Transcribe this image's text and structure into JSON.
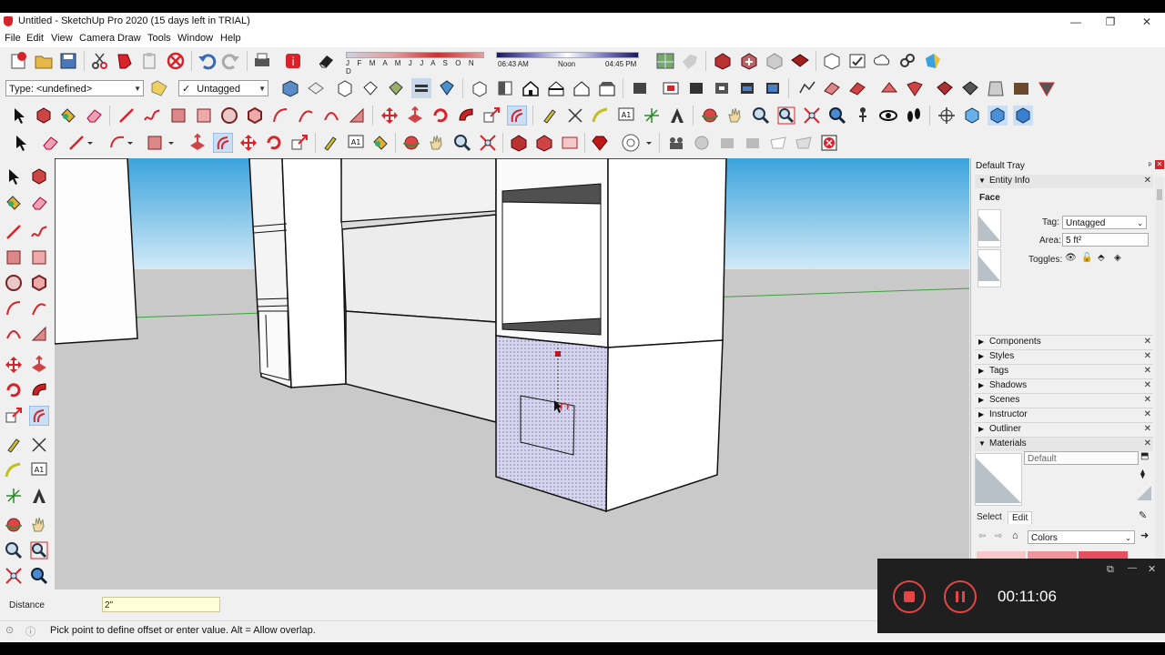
{
  "window": {
    "title": "Untitled - SketchUp Pro 2020 (15 days left in TRIAL)",
    "minimize_glyph": "—",
    "restore_glyph": "❐",
    "close_glyph": "✕"
  },
  "menu": [
    "File",
    "Edit",
    "View",
    "Camera",
    "Draw",
    "Tools",
    "Window",
    "Help"
  ],
  "shadow_settings": {
    "months": "J F M A M J J A S O N D",
    "time_start": "06:43 AM",
    "time_mid": "Noon",
    "time_end": "04:45 PM"
  },
  "toolbar2": {
    "type_combo": "Type: <undefined>",
    "tag_combo_check": "✓",
    "tag_combo": "Untagged"
  },
  "default_tray": {
    "title": "Default Tray",
    "pin_glyph": "ᵖ",
    "close_glyph": "✕",
    "entity_info": {
      "title": "Entity Info",
      "entity_type": "Face",
      "tag_label": "Tag:",
      "tag_value": "Untagged",
      "area_label": "Area:",
      "area_value": "5 ft²",
      "toggles_label": "Toggles:"
    },
    "panels": [
      "Components",
      "Styles",
      "Tags",
      "Shadows",
      "Scenes",
      "Instructor",
      "Outliner"
    ],
    "materials": {
      "title": "Materials",
      "material_name": "Default",
      "tab_select": "Select",
      "tab_edit": "Edit",
      "library_combo": "Colors",
      "swatch_colors": [
        "#f8c8c8",
        "#f1949b",
        "#e9505f"
      ]
    }
  },
  "vcb": {
    "label": "Distance",
    "value": "2\""
  },
  "status": {
    "message": "Pick point to define offset or enter value. Alt = Allow overlap.",
    "geo_glyph": "⊙",
    "info_glyph": "ⓘ"
  },
  "recorder": {
    "timer": "00:11:06",
    "popout_glyph": "⧉",
    "minimize_glyph": "—",
    "close_glyph": "✕"
  },
  "colors": {
    "accent_red": "#d8232a",
    "recorder_red": "#e54545",
    "sky_top": "#3ba3dd",
    "ground": "#c9c9c9",
    "selection_fill": "#cfcde8"
  }
}
